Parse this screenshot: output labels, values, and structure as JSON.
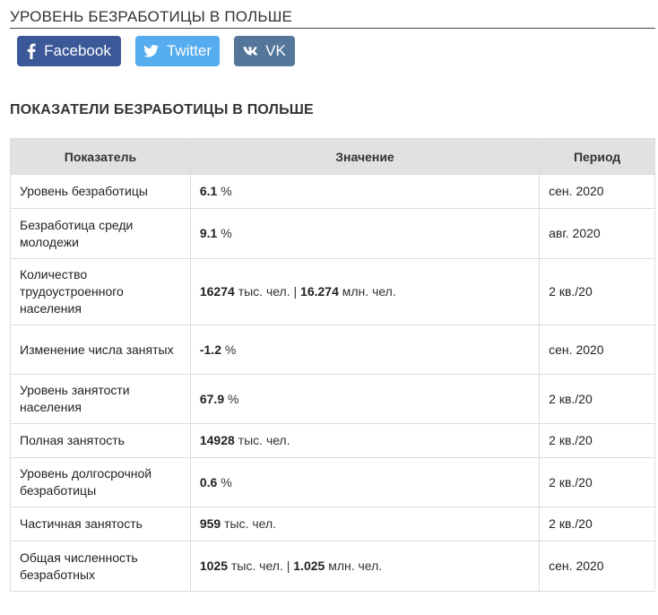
{
  "page_title": "УРОВЕНЬ БЕЗРАБОТИЦЫ В ПОЛЬШЕ",
  "share": [
    {
      "label": "Facebook",
      "icon": "facebook-icon",
      "color": "#3b5998"
    },
    {
      "label": "Twitter",
      "icon": "twitter-icon",
      "color": "#55acee"
    },
    {
      "label": "VK",
      "icon": "vk-icon",
      "color": "#54769a"
    }
  ],
  "section_title": "ПОКАЗАТЕЛИ БЕЗРАБОТИЦЫ В ПОЛЬШЕ",
  "table": {
    "headers": [
      "Показатель",
      "Значение",
      "Период"
    ],
    "rows": [
      {
        "name": "Уровень безработицы",
        "value": "6.1",
        "unit": "%",
        "value2": "",
        "unit2": "",
        "period": "сен. 2020"
      },
      {
        "name": "Безработица среди молодежи",
        "value": "9.1",
        "unit": "%",
        "value2": "",
        "unit2": "",
        "period": "авг. 2020"
      },
      {
        "name": "Количество трудоустроенного населения",
        "value": "16274",
        "unit": "тыс. чел. |",
        "value2": "16.274",
        "unit2": "млн. чел.",
        "period": "2 кв./20"
      },
      {
        "name": "Изменение числа занятых",
        "value": "-1.2",
        "unit": "%",
        "value2": "",
        "unit2": "",
        "period": "сен. 2020"
      },
      {
        "name": "Уровень занятости населения",
        "value": "67.9",
        "unit": "%",
        "value2": "",
        "unit2": "",
        "period": "2 кв./20"
      },
      {
        "name": "Полная занятость",
        "value": "14928",
        "unit": "тыс. чел.",
        "value2": "",
        "unit2": "",
        "period": "2 кв./20"
      },
      {
        "name": "Уровень долгосрочной безработицы",
        "value": "0.6",
        "unit": "%",
        "value2": "",
        "unit2": "",
        "period": "2 кв./20"
      },
      {
        "name": "Частичная занятость",
        "value": "959",
        "unit": "тыс. чел.",
        "value2": "",
        "unit2": "",
        "period": "2 кв./20"
      },
      {
        "name": "Общая численность безработных",
        "value": "1025",
        "unit": "тыс. чел. |",
        "value2": "1.025",
        "unit2": "млн. чел.",
        "period": "сен. 2020"
      }
    ]
  }
}
